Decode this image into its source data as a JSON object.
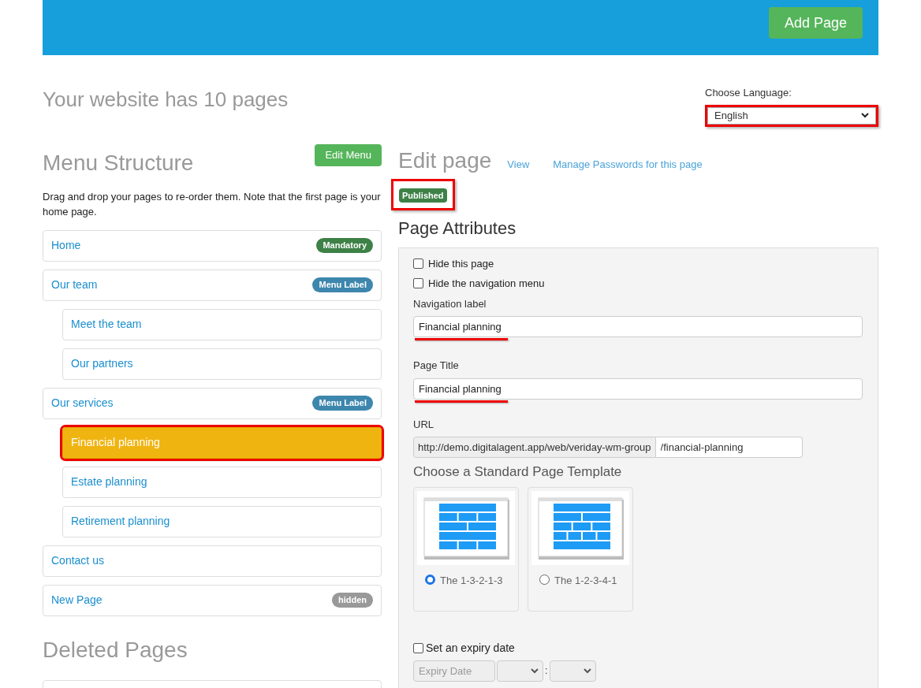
{
  "header": {
    "button": "Add Page"
  },
  "page_count": "Your website has 10 pages",
  "language": {
    "label": "Choose Language:",
    "value": "English",
    "highlighted": true
  },
  "menu": {
    "title": "Menu Structure",
    "button": "Edit Menu",
    "description": "Drag and drop your pages to re-order them. Note that the first page is your home page.",
    "items": [
      {
        "label": "Home",
        "badge": "Mandatory",
        "color": "#3e8147",
        "selected": false,
        "highlighted": false
      },
      {
        "label": "Our team",
        "badge": "Menu Label",
        "color": "#3d86ad",
        "selected": false,
        "highlighted": false,
        "children": [
          {
            "label": "Meet the team",
            "selected": false,
            "highlighted": false
          },
          {
            "label": "Our partners",
            "selected": false,
            "highlighted": false
          }
        ]
      },
      {
        "label": "Our services",
        "badge": "Menu Label",
        "color": "#3d86ad",
        "selected": false,
        "highlighted": false,
        "children": [
          {
            "label": "Financial planning",
            "selected": true,
            "highlighted": true
          },
          {
            "label": "Estate planning",
            "selected": false,
            "highlighted": false
          },
          {
            "label": "Retirement planning",
            "selected": false,
            "highlighted": false
          }
        ]
      },
      {
        "label": "Contact us",
        "selected": false,
        "highlighted": false
      },
      {
        "label": "New Page",
        "badge": "hidden",
        "color": "#999999",
        "selected": false,
        "highlighted": false
      }
    ]
  },
  "deleted": {
    "title": "Deleted Pages"
  },
  "edit": {
    "title": "Edit page",
    "links": [
      "View",
      "Manage Passwords for this page"
    ],
    "status": "Published",
    "status_highlighted": true
  },
  "attributes": {
    "title": "Page Attributes",
    "checkboxes": [
      {
        "label": "Hide this page",
        "checked": false
      },
      {
        "label": "Hide the navigation menu",
        "checked": false
      }
    ],
    "fields": [
      {
        "label": "Navigation label",
        "value": "Financial planning",
        "underlined": true
      },
      {
        "label": "Page Title",
        "value": "Financial planning",
        "underlined": true
      }
    ],
    "url": {
      "label": "URL",
      "prefix": "http://demo.digitalagent.app/web/veriday-wm-group",
      "value": "/financial-planning"
    },
    "template_title": "Choose a Standard Page Template",
    "templates": [
      {
        "label": "The 1-3-2-1-3",
        "selected": true
      },
      {
        "label": "The 1-2-3-4-1",
        "selected": false
      }
    ],
    "expiry": {
      "label": "Set an expiry date",
      "checked": false,
      "placeholder": "Expiry Date",
      "separator": ":"
    }
  }
}
